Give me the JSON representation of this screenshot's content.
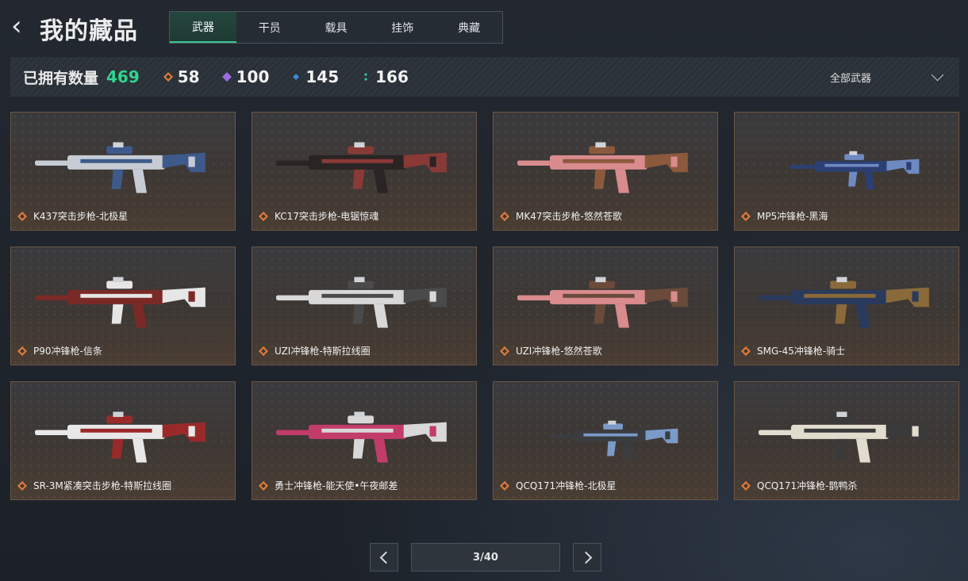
{
  "header": {
    "title": "我的藏品",
    "tabs": [
      {
        "label": "武器",
        "active": true
      },
      {
        "label": "干员",
        "active": false
      },
      {
        "label": "载具",
        "active": false
      },
      {
        "label": "挂饰",
        "active": false
      },
      {
        "label": "典藏",
        "active": false
      }
    ]
  },
  "stats": {
    "label": "已拥有数量",
    "total": "469",
    "rarities": [
      {
        "icon": "orange-diamond-icon",
        "color": "#e07b39",
        "count": "58"
      },
      {
        "icon": "purple-diamond-icon",
        "color": "#9b6be0",
        "count": "100"
      },
      {
        "icon": "blue-diamond-icon",
        "color": "#3e86d6",
        "count": "145"
      },
      {
        "icon": "green-dots-icon",
        "color": "#2fc7a0",
        "count": "166"
      }
    ],
    "filter": "全部武器"
  },
  "items": [
    {
      "name": "K437突击步枪-北极星",
      "colors": [
        "#c7ccd4",
        "#3d5a8a"
      ]
    },
    {
      "name": "KC17突击步枪-电锯惊魂",
      "colors": [
        "#2a2424",
        "#8a3a36"
      ]
    },
    {
      "name": "MK47突击步枪-悠然苍歌",
      "colors": [
        "#d98b8e",
        "#8b5a3c"
      ]
    },
    {
      "name": "MP5冲锋枪-黑海",
      "colors": [
        "#2b3f72",
        "#6f8ac2"
      ]
    },
    {
      "name": "P90冲锋枪-信条",
      "colors": [
        "#7a2a26",
        "#e6e6e6"
      ]
    },
    {
      "name": "UZI冲锋枪-特斯拉线圈",
      "colors": [
        "#d8d8d8",
        "#4a4a4a"
      ]
    },
    {
      "name": "UZI冲锋枪-悠然苍歌",
      "colors": [
        "#d98b8e",
        "#6a4a3a"
      ]
    },
    {
      "name": "SMG-45冲锋枪-骑士",
      "colors": [
        "#2a3a5c",
        "#8a6a3a"
      ]
    },
    {
      "name": "SR-3M紧凑突击步枪-特斯拉线圈",
      "colors": [
        "#e8e8e8",
        "#9a2a2a"
      ]
    },
    {
      "name": "勇士冲锋枪-能天使•午夜邮差",
      "colors": [
        "#c23c6a",
        "#d8d8d8"
      ]
    },
    {
      "name": "QCQ171冲锋枪-北极星",
      "colors": [
        "#3a3c40",
        "#7a9ac8"
      ]
    },
    {
      "name": "QCQ171冲锋枪-鹊鸭杀",
      "colors": [
        "#e2dccf",
        "#3a3a3a"
      ]
    }
  ],
  "pagination": {
    "current": "3/40"
  }
}
